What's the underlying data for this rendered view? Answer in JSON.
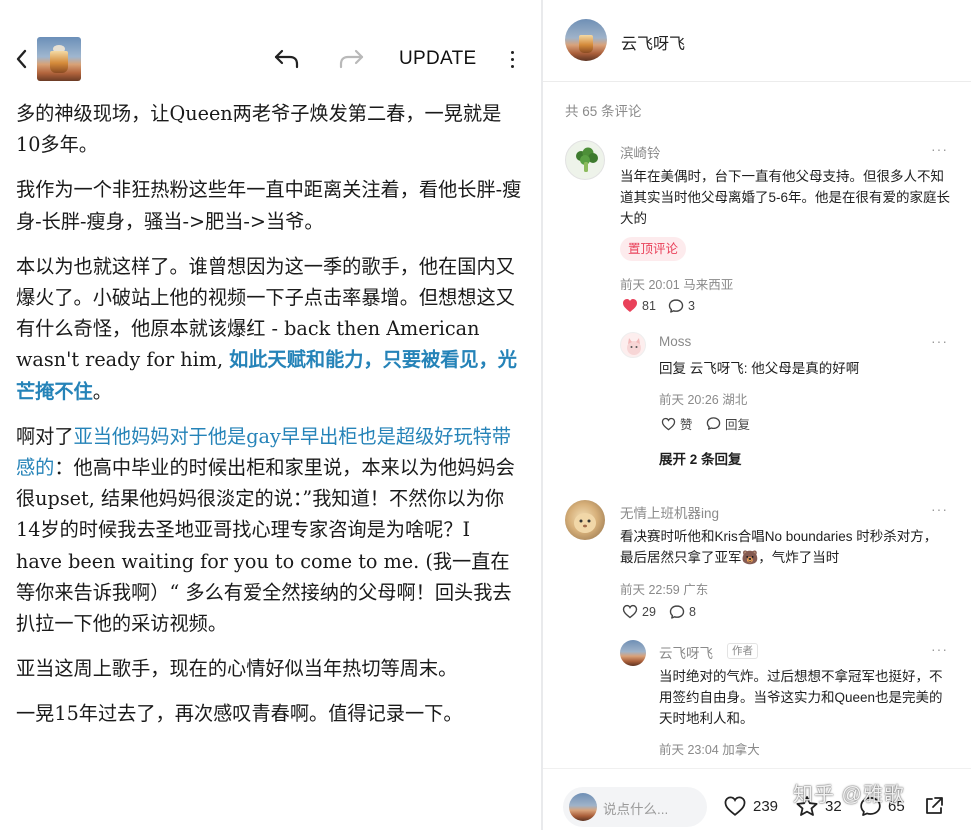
{
  "reader": {
    "update_label": "UPDATE",
    "paragraphs": [
      {
        "segments": [
          {
            "text": "多的神级现场，让Queen两老爷子焕发第二春，一晃就是10多年。",
            "style": "plain"
          }
        ]
      },
      {
        "segments": [
          {
            "text": "我作为一个非狂热粉这些年一直中距离关注着，看他长胖-瘦身-长胖-瘦身，骚当->肥当->当爷。",
            "style": "plain"
          }
        ]
      },
      {
        "segments": [
          {
            "text": "本以为也就这样了。谁曾想因为这一季的歌手，他在国内又爆火了。小破站上他的视频一下子点击率暴增。但想想这又有什么奇怪，他原本就该爆红 - back then American wasn't ready for him, ",
            "style": "plain"
          },
          {
            "text": "如此天赋和能力，只要被看见，光芒掩不住",
            "style": "highlight-bold"
          },
          {
            "text": "。",
            "style": "plain"
          }
        ]
      },
      {
        "segments": [
          {
            "text": "啊对了",
            "style": "plain"
          },
          {
            "text": "亚当他妈妈对于他是gay早早出柜也是超级好玩特带感的",
            "style": "highlight"
          },
          {
            "text": "：他高中毕业的时候出柜和家里说，本来以为他妈妈会很upset, 结果他妈妈很淡定的说：”我知道！不然你以为你14岁的时候我去圣地亚哥找心理专家咨询是为啥呢？I have been waiting for you to come to me. (我一直在等你来告诉我啊）“ 多么有爱全然接纳的父母啊！回头我去扒拉一下他的采访视频。",
            "style": "plain"
          }
        ]
      },
      {
        "segments": [
          {
            "text": "亚当这周上歌手，现在的心情好似当年热切等周末。",
            "style": "plain"
          }
        ]
      },
      {
        "segments": [
          {
            "text": "一晃15年过去了，再次感叹青春啊。值得记录一下。",
            "style": "plain"
          }
        ]
      }
    ]
  },
  "comments_panel": {
    "author_name": "云飞呀飞",
    "count_text": "共 65 条评论",
    "comment1": {
      "user": "滨崎铃",
      "text": "当年在美偶时，台下一直有他父母支持。但很多人不知道其实当时他父母离婚了5-6年。他是在很有爱的家庭长大的",
      "badge": "置顶评论",
      "meta": "前天 20:01 马来西亚",
      "likes": "81",
      "replies": "3"
    },
    "reply1": {
      "user": "Moss",
      "text": "回复 云飞呀飞: 他父母是真的好啊",
      "meta": "前天 20:26 湖北",
      "like_label": "赞",
      "reply_label": "回复"
    },
    "expand_label": "展开 2 条回复",
    "comment2": {
      "user": "无情上班机器ing",
      "text": "看决赛时听他和Kris合唱No boundaries 时秒杀对方，最后居然只拿了亚军🐻，气炸了当时",
      "meta": "前天 22:59 广东",
      "likes": "29",
      "replies": "8"
    },
    "reply2": {
      "user": "云飞呀飞",
      "tag": "作者",
      "text": "当时绝对的气炸。过后想想不拿冠军也挺好，不用签约自由身。当爷这实力和Queen也是完美的天时地利人和。",
      "meta": "前天 23:04 加拿大"
    },
    "more_glyph": "···"
  },
  "bottom_bar": {
    "placeholder": "说点什么...",
    "likes": "239",
    "favorites": "32",
    "comments": "65"
  },
  "watermark": "知乎 @雅歌",
  "colors": {
    "accent": "#2583b8",
    "like_red": "#e9415a",
    "badge_bg": "#fdebed"
  }
}
